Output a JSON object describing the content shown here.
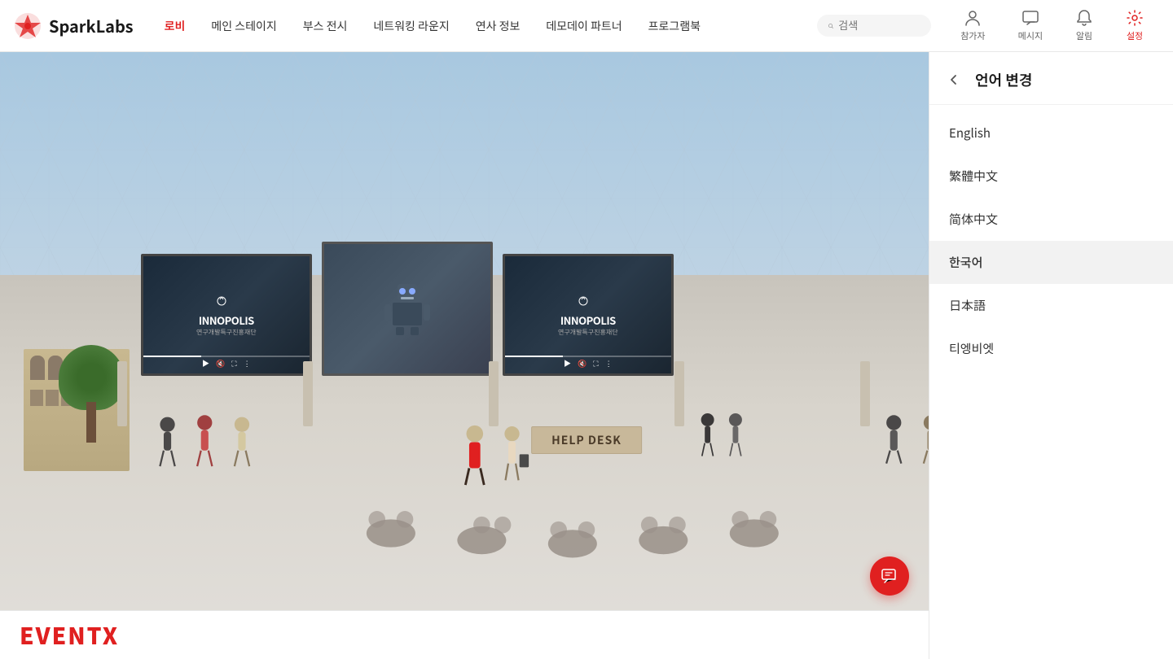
{
  "header": {
    "logo_text": "SparkLabs",
    "nav_items": [
      {
        "id": "lobby",
        "label": "로비",
        "active": true
      },
      {
        "id": "main-stage",
        "label": "메인 스테이지",
        "active": false
      },
      {
        "id": "booth-exhibit",
        "label": "부스 전시",
        "active": false
      },
      {
        "id": "networking-lounge",
        "label": "네트워킹 라운지",
        "active": false
      },
      {
        "id": "speaker-info",
        "label": "연사 정보",
        "active": false
      },
      {
        "id": "demo-day-partner",
        "label": "데모데이 파트너",
        "active": false
      },
      {
        "id": "program-book",
        "label": "프로그램북",
        "active": false
      }
    ],
    "search_placeholder": "검색",
    "actions": [
      {
        "id": "participants",
        "label": "참가자",
        "icon": "person-icon"
      },
      {
        "id": "messages",
        "label": "메시지",
        "icon": "chat-icon"
      },
      {
        "id": "notifications",
        "label": "알림",
        "icon": "bell-icon"
      },
      {
        "id": "settings",
        "label": "설정",
        "icon": "gear-icon",
        "active": true
      }
    ]
  },
  "language_panel": {
    "title": "언어 변경",
    "back_label": "back",
    "languages": [
      {
        "id": "english",
        "label": "English",
        "selected": false
      },
      {
        "id": "traditional-chinese",
        "label": "繁體中文",
        "selected": false
      },
      {
        "id": "simplified-chinese",
        "label": "简体中文",
        "selected": false
      },
      {
        "id": "korean",
        "label": "한국어",
        "selected": true
      },
      {
        "id": "japanese",
        "label": "日本語",
        "selected": false
      },
      {
        "id": "vietnamese",
        "label": "티엥비엣",
        "selected": false
      }
    ]
  },
  "venue": {
    "help_desk_text": "HELP DESK",
    "screen_left_title": "INNOPOLIS",
    "screen_left_sub": "연구개발특구진흥재단",
    "screen_right_title": "INNOPOLIS",
    "screen_right_sub": "연구개발특구진흥재단"
  },
  "bottom_bar": {
    "eventx_logo": "EVENTX"
  },
  "fab": {
    "icon": "feedback-icon"
  },
  "colors": {
    "primary_red": "#e02020",
    "nav_active": "#e02020",
    "bg_white": "#ffffff"
  }
}
